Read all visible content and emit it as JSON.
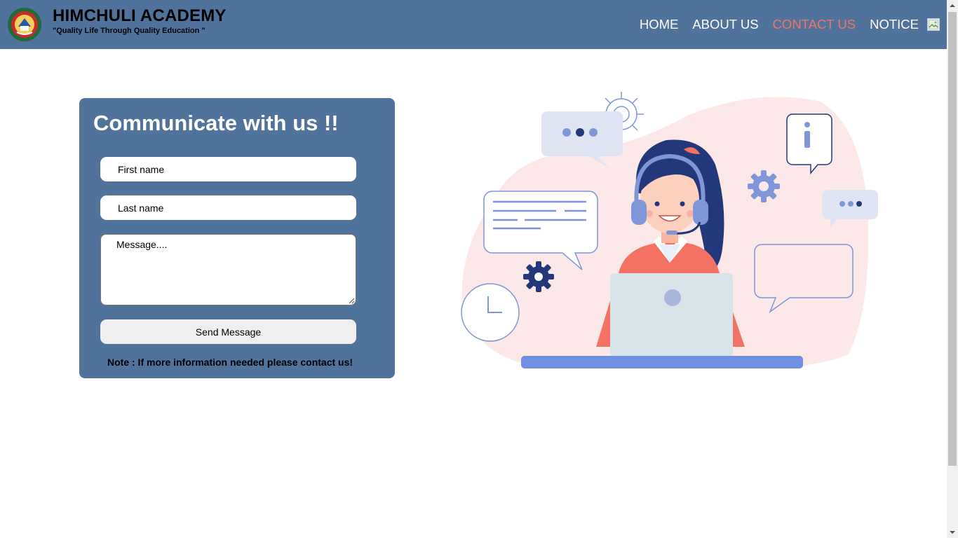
{
  "header": {
    "title": "HIMCHULI ACADEMY",
    "tagline": "\"Quality Life Through Quality Education \"",
    "nav": [
      {
        "label": "HOME",
        "active": false
      },
      {
        "label": "ABOUT US",
        "active": false
      },
      {
        "label": "CONTACT US",
        "active": true
      },
      {
        "label": "NOTICE",
        "active": false
      }
    ]
  },
  "form": {
    "title": "Communicate with us !!",
    "first_name_placeholder": "First name",
    "last_name_placeholder": "Last name",
    "message_placeholder": "Message....",
    "send_label": "Send Message",
    "note": "Note : If more information needed please contact us!"
  },
  "colors": {
    "header_bg": "#50739c",
    "active_nav": "#f47264",
    "card_bg": "#50739c"
  },
  "icons": {
    "logo": "school-emblem-icon",
    "notice_image": "broken-image-icon",
    "illustration": "support-agent-illustration"
  }
}
